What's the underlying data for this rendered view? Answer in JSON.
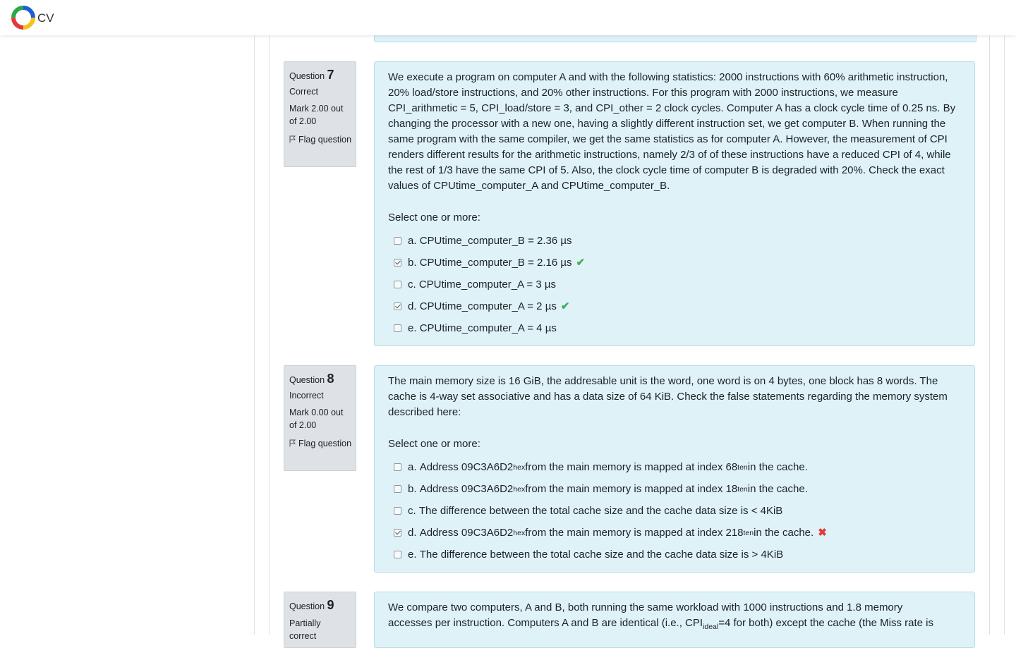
{
  "app": {
    "logo_text": "CV"
  },
  "questions": [
    {
      "label": "Question",
      "number": "7",
      "state": "Correct",
      "grade": "Mark 2.00 out of 2.00",
      "flag": "Flag question",
      "text": "We execute a program on computer A and with the following statistics: 2000 instructions with 60% arithmetic instruction, 20% load/store instructions, and 20% other instructions.  For this program with 2000 instructions, we measure CPI_arithmetic = 5, CPI_load/store = 3, and CPI_other = 2 clock cycles. Computer A has a clock cycle time of 0.25 ns. By changing the processor with a new one, having a slightly different instruction set, we get computer B. When running the same program with the same compiler, we get the same statistics as for computer A. However, the measurement of CPI renders different results for the arithmetic instructions, namely 2/3 of of these instructions have a reduced CPI of 4, while the rest of 1/3 have the same CPI of 5. Also, the clock cycle time of computer B is degraded with 20%. Check the exact values of CPUtime_computer_A and CPUtime_computer_B.",
      "prompt": "Select one or more:",
      "options": [
        {
          "letter": "a.",
          "text": "CPUtime_computer_B = 2.36 µs",
          "checked": false,
          "feedback": ""
        },
        {
          "letter": "b.",
          "text": "CPUtime_computer_B = 2.16 µs",
          "checked": true,
          "feedback": "correct"
        },
        {
          "letter": "c.",
          "text": "CPUtime_computer_A = 3 µs",
          "checked": false,
          "feedback": ""
        },
        {
          "letter": "d.",
          "text": "CPUtime_computer_A = 2 µs",
          "checked": true,
          "feedback": "correct"
        },
        {
          "letter": "e.",
          "text": "CPUtime_computer_A = 4 µs",
          "checked": false,
          "feedback": ""
        }
      ]
    },
    {
      "label": "Question",
      "number": "8",
      "state": "Incorrect",
      "grade": "Mark 0.00 out of 2.00",
      "flag": "Flag question",
      "text": "The main memory size is 16 GiB, the addresable unit is the word, one word is on 4 bytes, one block has 8 words. The cache is 4-way set associative and has a data size of 64 KiB. Check the false statements regarding the memory system described here:",
      "prompt": "Select one or more:",
      "options": [
        {
          "letter": "a.",
          "p1": "Address 09C3A6D2",
          "s1": "hex",
          "p2": " from the main memory is mapped at index 68",
          "s2": "ten",
          "p3": " in the cache.",
          "checked": false,
          "feedback": ""
        },
        {
          "letter": "b.",
          "p1": "Address 09C3A6D2",
          "s1": "hex",
          "p2": " from the main memory is mapped at index 18",
          "s2": "ten",
          "p3": " in the cache.",
          "checked": false,
          "feedback": ""
        },
        {
          "letter": "c.",
          "text": "The difference between the total cache size and the cache data size is < 4KiB",
          "checked": false,
          "feedback": ""
        },
        {
          "letter": "d.",
          "p1": "Address 09C3A6D2",
          "s1": "hex",
          "p2": " from the main memory is mapped at index 218",
          "s2": "ten",
          "p3": " in the cache.",
          "checked": true,
          "feedback": "incorrect"
        },
        {
          "letter": "e.",
          "text": "The difference between the total cache size and the cache data size is > 4KiB",
          "checked": false,
          "feedback": ""
        }
      ]
    },
    {
      "label": "Question",
      "number": "9",
      "state": "Partially correct",
      "text_line1": "We compare two computers, A and B, both running the same workload with 1000 instructions and 1.8 memory",
      "text_line2_a": "accesses per instruction. Computers A and B are identical (i.e., CPI",
      "text_line2_sub": "ideal",
      "text_line2_b": "=4 for both) except the cache (the Miss rate  is"
    }
  ],
  "icons": {
    "correct": "check-icon",
    "incorrect": "cross-icon",
    "flag": "flag-icon"
  },
  "colors": {
    "content_bg": "#def2f8",
    "info_bg": "#dee2e6",
    "correct": "#3fae53",
    "incorrect": "#dd3c3c"
  }
}
